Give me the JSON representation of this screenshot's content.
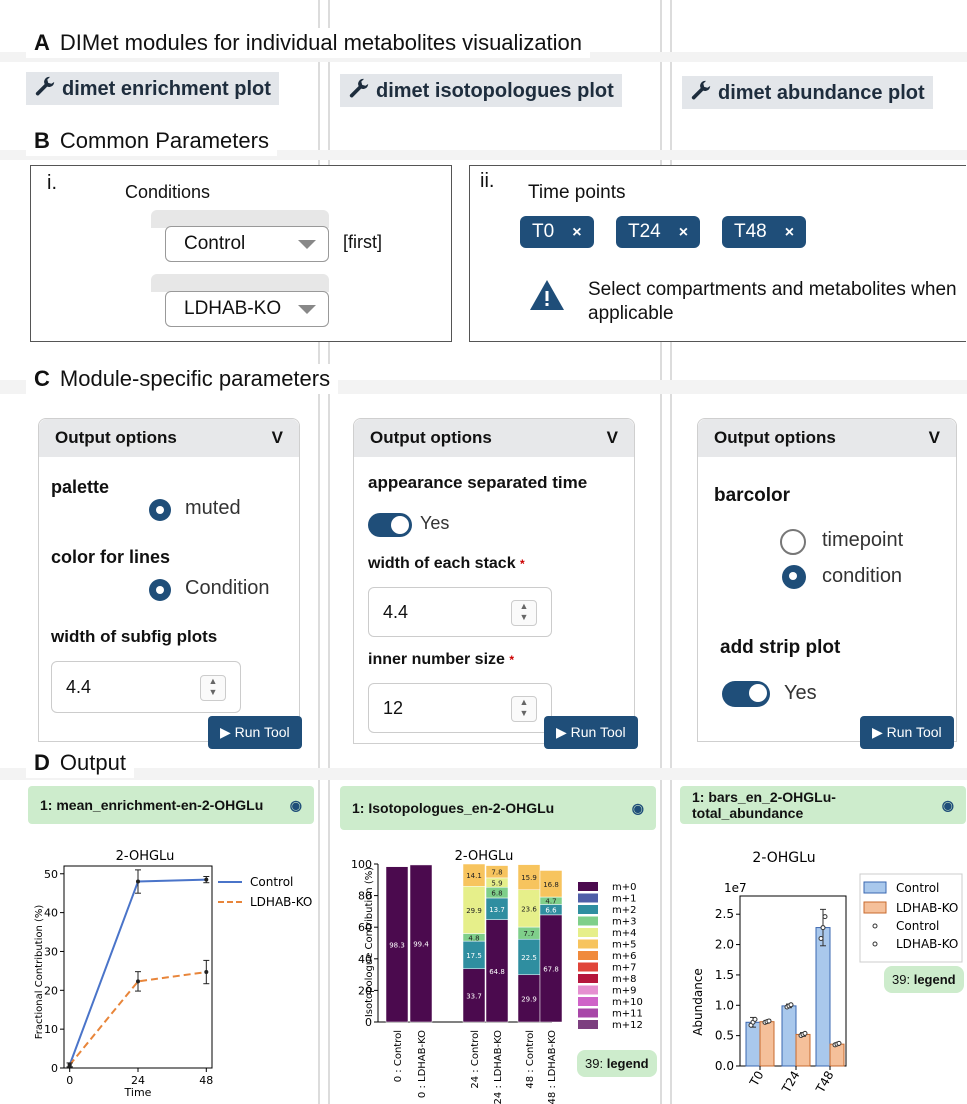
{
  "sections": {
    "A": {
      "letter": "A",
      "title": "DIMet modules for individual metabolites visualization"
    },
    "B": {
      "letter": "B",
      "title": "Common Parameters"
    },
    "C": {
      "letter": "C",
      "title": "Module-specific parameters"
    },
    "D": {
      "letter": "D",
      "title": "Output"
    }
  },
  "tools": [
    "dimet enrichment plot",
    "dimet isotopologues plot",
    "dimet abundance plot"
  ],
  "common": {
    "conditions": {
      "roman": "i.",
      "label": "Conditions",
      "first": "Control",
      "first_tag": "[first]",
      "second": "LDHAB-KO"
    },
    "timepoints": {
      "roman": "ii.",
      "label": "Time points",
      "chips": [
        "T0",
        "T24",
        "T48"
      ],
      "close": "×",
      "warning": "Select compartments and metabolites when applicable",
      "warning_icon": "warning-icon"
    }
  },
  "modules": {
    "enrichment": {
      "header": "Output options",
      "chevron": "V",
      "palette_label": "palette",
      "palette_value": "muted",
      "lines_label": "color for lines",
      "lines_value": "Condition",
      "width_label": "width of subfig plots",
      "width_value": "4.4",
      "run": "Run Tool"
    },
    "isotopologues": {
      "header": "Output options",
      "chevron": "V",
      "sep_label": "appearance separated time",
      "sep_value": "Yes",
      "stack_label": "width of each stack",
      "stack_value": "4.4",
      "inner_label": "inner number size",
      "inner_value": "12",
      "req": "*",
      "run": "Run Tool"
    },
    "abundance": {
      "header": "Output options",
      "chevron": "V",
      "barcolor_label": "barcolor",
      "opt1": "timepoint",
      "opt2": "condition",
      "strip_label": "add strip plot",
      "strip_value": "Yes",
      "run": "Run Tool"
    }
  },
  "outputs": [
    "1: mean_enrichment-en-2-OHGLu",
    "1: Isotopologues_en-2-OHGLu",
    "1: bars_en_2-OHGLu-total_abundance"
  ],
  "legend_badge": {
    "num": "39:",
    "word": "legend"
  },
  "colors": {
    "primary": "#1f4e79",
    "output_bg": "#cdeccc",
    "control": "#4a74c9",
    "ko": "#e8853a"
  },
  "chart_data": [
    {
      "type": "line",
      "title": "2-OHGLu",
      "xlabel": "Time",
      "ylabel": "Fractional Contribution (%)",
      "x": [
        0,
        24,
        48
      ],
      "xticks": [
        0,
        24,
        48
      ],
      "yticks": [
        0,
        10,
        20,
        30,
        40,
        50
      ],
      "ylim": [
        0,
        52
      ],
      "series": [
        {
          "name": "Control",
          "values": [
            0.8,
            48,
            48.5
          ],
          "err": [
            0.5,
            3,
            0.8
          ],
          "style": "solid"
        },
        {
          "name": "LDHAB-KO",
          "values": [
            0.8,
            22.3,
            24.7
          ],
          "err": [
            0.5,
            2.5,
            3
          ],
          "style": "dashed"
        }
      ]
    },
    {
      "type": "bar",
      "title": "2-OHGLu",
      "ylabel": "Isotopologue Contribution (%)",
      "categories": [
        "0 : Control",
        "0 : LDHAB-KO",
        "24 : Control",
        "24 : LDHAB-KO",
        "48 : Control",
        "48 : LDHAB-KO"
      ],
      "yticks": [
        0,
        20,
        40,
        60,
        80,
        100
      ],
      "stacked": true,
      "series": [
        {
          "name": "m+0",
          "values": [
            98.3,
            99.4,
            33.7,
            64.8,
            29.9,
            67.8
          ]
        },
        {
          "name": "m+1",
          "values": [
            0,
            0,
            0,
            0,
            0,
            0
          ]
        },
        {
          "name": "m+2",
          "values": [
            0,
            0,
            17.5,
            13.7,
            22.5,
            6.6
          ]
        },
        {
          "name": "m+3",
          "values": [
            0,
            0,
            4.8,
            6.8,
            7.7,
            4.7
          ]
        },
        {
          "name": "m+4",
          "values": [
            0,
            0,
            29.9,
            5.9,
            23.6,
            0
          ]
        },
        {
          "name": "m+5",
          "values": [
            0,
            0,
            14.1,
            7.8,
            15.9,
            16.8
          ]
        },
        {
          "name": "m+6",
          "values": [
            0,
            0,
            0,
            0,
            0,
            0
          ]
        },
        {
          "name": "m+7",
          "values": [
            0,
            0,
            0,
            0,
            0,
            0
          ]
        },
        {
          "name": "m+8",
          "values": [
            0,
            0,
            0,
            0,
            0,
            0
          ]
        },
        {
          "name": "m+9",
          "values": [
            0,
            0,
            0,
            0,
            0,
            0
          ]
        },
        {
          "name": "m+10",
          "values": [
            0,
            0,
            0,
            0,
            0,
            0
          ]
        },
        {
          "name": "m+11",
          "values": [
            0,
            0,
            0,
            0,
            0,
            0
          ]
        },
        {
          "name": "m+12",
          "values": [
            0,
            0,
            0,
            0,
            0,
            0
          ]
        }
      ],
      "series_colors": [
        "#4b0a4e",
        "#4f5fa8",
        "#2f8ea0",
        "#7fcf8a",
        "#e6ef8a",
        "#f7c45e",
        "#f08a3c",
        "#e0453a",
        "#b5163c",
        "#e58fd0",
        "#cf63c8",
        "#a847a8",
        "#7c3f7f"
      ]
    },
    {
      "type": "bar",
      "title": "2-OHGLu",
      "ylabel": "Abundance",
      "exponent": "1e7",
      "categories": [
        "T0",
        "T24",
        "T48"
      ],
      "yticks": [
        0.0,
        0.5,
        1.0,
        1.5,
        2.0,
        2.5
      ],
      "ylim": [
        0,
        2.8
      ],
      "series": [
        {
          "name": "Control",
          "values": [
            0.72,
            0.99,
            2.28
          ],
          "err": [
            0.08,
            0.03,
            0.3
          ]
        },
        {
          "name": "LDHAB-KO",
          "values": [
            0.73,
            0.52,
            0.36
          ],
          "err": [
            0.02,
            0.03,
            0.02
          ]
        }
      ],
      "strip_names": [
        "Control",
        "LDHAB-KO"
      ]
    }
  ]
}
